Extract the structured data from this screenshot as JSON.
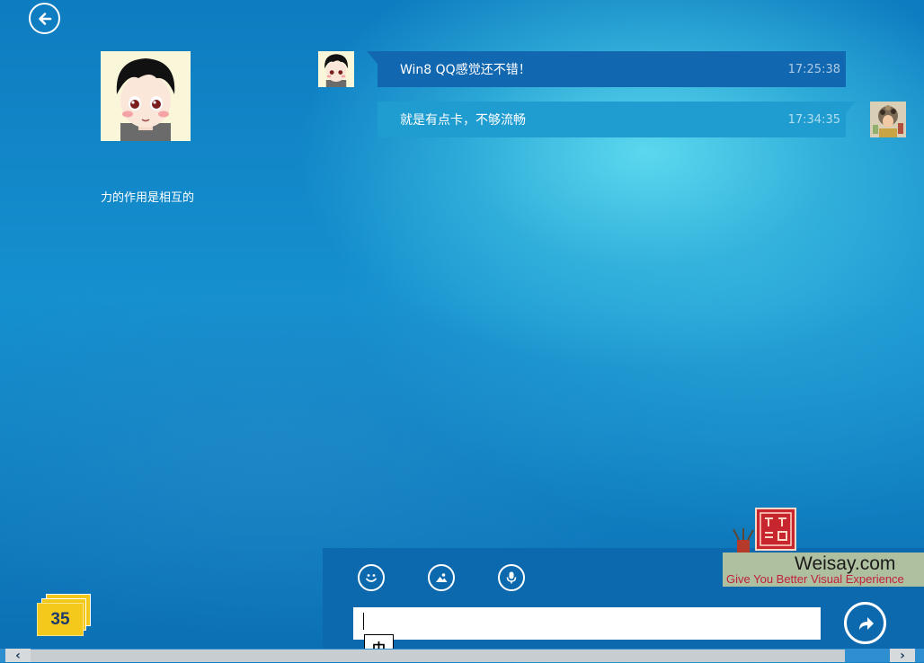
{
  "header": {
    "back_icon": "back-arrow-icon"
  },
  "contact": {
    "avatar_icon": "cartoon-boy-avatar",
    "signature": "力的作用是相互的"
  },
  "messages": [
    {
      "direction": "incoming",
      "text": "Win8 QQ感觉还不错！",
      "time": "17:25:38",
      "avatar_icon": "cartoon-boy-avatar"
    },
    {
      "direction": "outgoing",
      "text": "就是有点卡，不够流畅",
      "time": "17:34:35",
      "avatar_icon": "self-avatar"
    }
  ],
  "toolbar": {
    "emoji_icon": "smiley-icon",
    "image_icon": "picture-icon",
    "voice_icon": "microphone-icon"
  },
  "compose": {
    "value": "",
    "ime_mode": "中",
    "send_icon": "send-arrow-icon"
  },
  "unread": {
    "count": "35"
  },
  "watermark": {
    "site": "Weisay.com",
    "tagline": "Give You Better Visual Experience"
  },
  "colors": {
    "incoming_bubble": "#1267b1",
    "outgoing_bubble": "#1f9dd0",
    "compose_panel": "#0c69ae",
    "badge": "#f5c91b"
  }
}
